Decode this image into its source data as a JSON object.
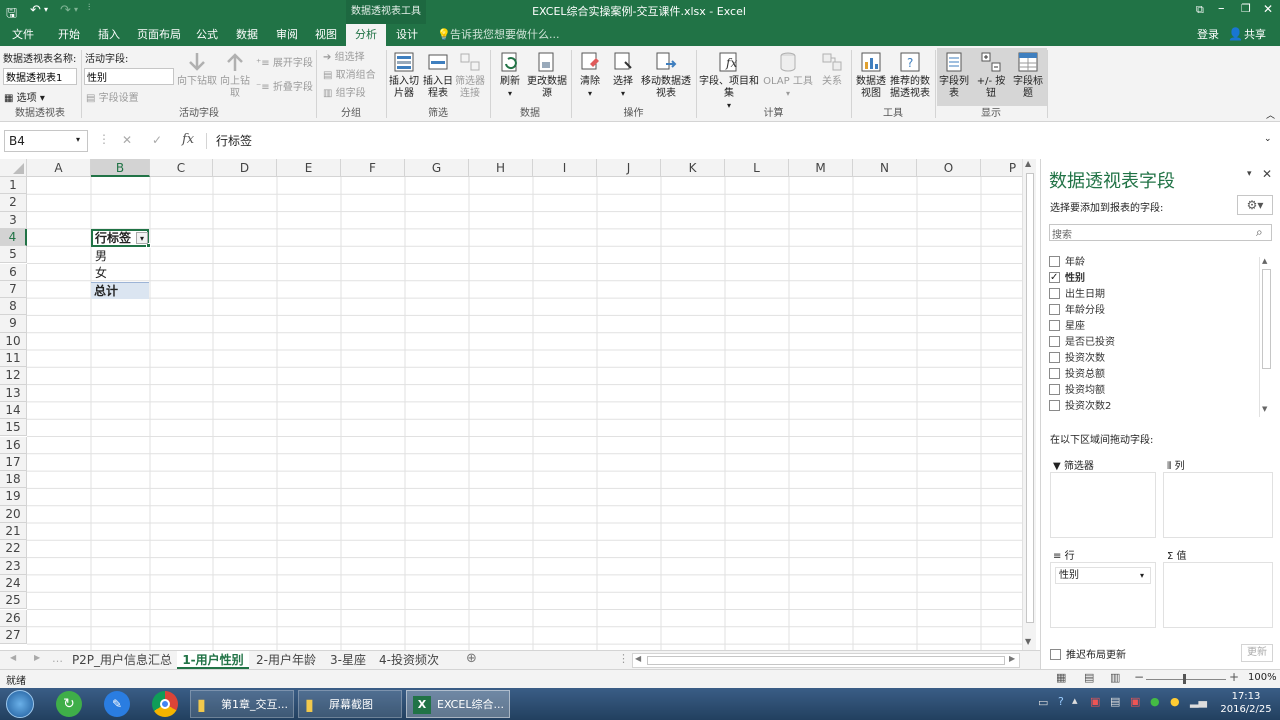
{
  "window": {
    "title": "EXCEL综合实操案例-交互课件.xlsx - Excel",
    "context_group": "数据透视表工具"
  },
  "qat": {
    "save": "save-icon",
    "undo": "undo-icon",
    "redo": "redo-icon",
    "customize": "customize-icon"
  },
  "menu": {
    "tabs": [
      "文件",
      "开始",
      "插入",
      "页面布局",
      "公式",
      "数据",
      "审阅",
      "视图",
      "分析",
      "设计"
    ],
    "active": "分析",
    "tell_me": "告诉我您想要做什么...",
    "login": "登录",
    "share": "共享"
  },
  "ribbon": {
    "pivot_name_label": "数据透视表名称:",
    "pivot_name_value": "数据透视表1",
    "options": "选项",
    "group_pivot": "数据透视表",
    "active_field_label": "活动字段:",
    "active_field_value": "性别",
    "field_settings": "字段设置",
    "drill_down": "向下钻取",
    "drill_up": "向上钻取",
    "expand": "展开字段",
    "collapse": "折叠字段",
    "group_active": "活动字段",
    "group_selection": "组选择",
    "ungroup": "取消组合",
    "group_field": "组字段",
    "group_group": "分组",
    "insert_slicer": "插入切片器",
    "insert_timeline": "插入日程表",
    "filter_connections": "筛选器连接",
    "group_filter": "筛选",
    "refresh": "刷新",
    "change_source": "更改数据源",
    "group_data": "数据",
    "clear": "清除",
    "select": "选择",
    "move": "移动数据透视表",
    "group_actions": "操作",
    "fields_items": "字段、项目和集",
    "olap": "OLAP 工具",
    "relations": "关系",
    "group_calc": "计算",
    "pivot_chart": "数据透视图",
    "recommended": "推荐的数据透视表",
    "group_tools": "工具",
    "field_list": "字段列表",
    "buttons": "+/- 按钮",
    "field_headers": "字段标题",
    "group_show": "显示"
  },
  "formula": {
    "cell": "B4",
    "content": "行标签"
  },
  "sheet": {
    "columns": [
      "A",
      "B",
      "C",
      "D",
      "E",
      "F",
      "G",
      "H",
      "I",
      "J",
      "K",
      "L",
      "M",
      "N",
      "O",
      "P"
    ],
    "rows": [
      "1",
      "2",
      "3",
      "4",
      "5",
      "6",
      "7",
      "8",
      "9",
      "10",
      "11",
      "12",
      "13",
      "14",
      "15",
      "16",
      "17",
      "18",
      "19",
      "20",
      "21",
      "22",
      "23",
      "24",
      "25",
      "26",
      "27"
    ],
    "pivot": {
      "header": "行标签",
      "items": [
        "男",
        "女"
      ],
      "total": "总计"
    }
  },
  "pane": {
    "title": "数据透视表字段",
    "subtitle": "选择要添加到报表的字段:",
    "search_placeholder": "搜索",
    "fields": [
      {
        "name": "年龄",
        "checked": false
      },
      {
        "name": "性别",
        "checked": true
      },
      {
        "name": "出生日期",
        "checked": false
      },
      {
        "name": "年龄分段",
        "checked": false
      },
      {
        "name": "星座",
        "checked": false
      },
      {
        "name": "是否已投资",
        "checked": false
      },
      {
        "name": "投资次数",
        "checked": false
      },
      {
        "name": "投资总额",
        "checked": false
      },
      {
        "name": "投资均额",
        "checked": false
      },
      {
        "name": "投资次数2",
        "checked": false
      }
    ],
    "drag_label": "在以下区域间拖动字段:",
    "area_filter": "筛选器",
    "area_columns": "列",
    "area_rows": "行",
    "area_values": "值",
    "row_field": "性别",
    "defer_label": "推迟布局更新",
    "update": "更新"
  },
  "tabs": {
    "items": [
      "P2P_用户信息汇总",
      "1-用户性别",
      "2-用户年龄",
      "3-星座",
      "4-投资频次"
    ],
    "active": "1-用户性别"
  },
  "status": {
    "ready": "就绪",
    "zoom": "100%"
  },
  "taskbar": {
    "items": [
      "第1章_交互...",
      "屏幕截图",
      "EXCEL综合..."
    ],
    "time": "17:13",
    "date": "2016/2/25"
  },
  "colors": {
    "excel_green": "#217346",
    "selection": "#dbe5f1"
  }
}
